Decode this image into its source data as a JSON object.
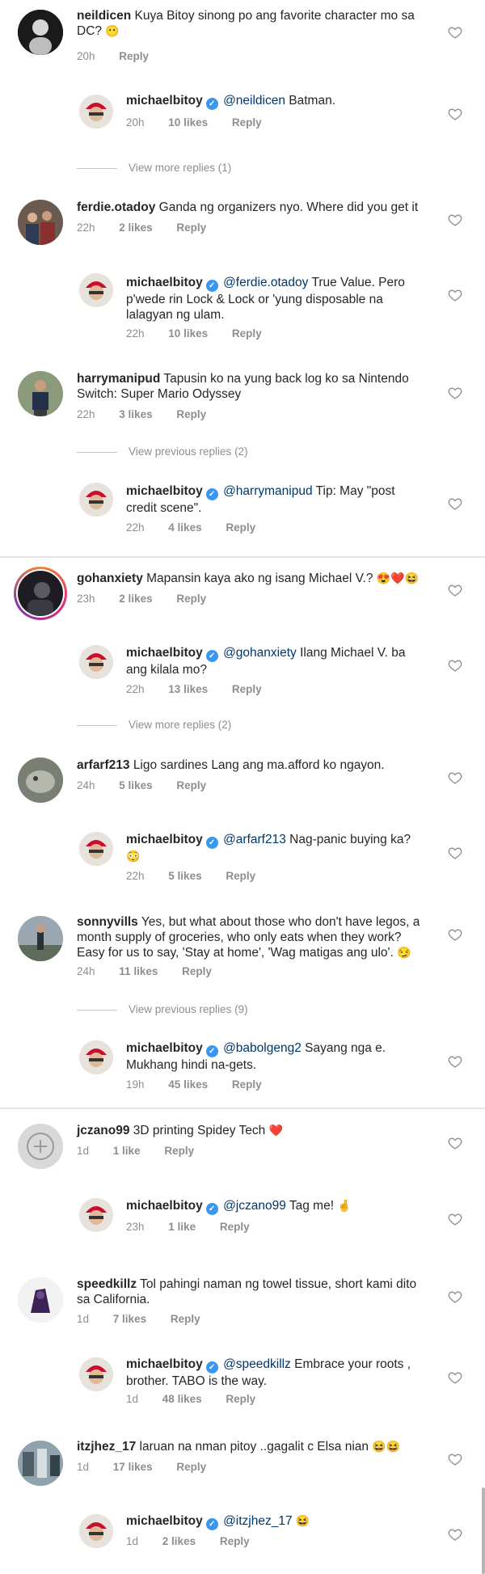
{
  "comments": [
    {
      "user": "neildicen",
      "text": "Kuya Bitoy sinong po ang favorite character mo sa DC?",
      "emoji": "😶",
      "time": "20h",
      "likes": "",
      "reply": "Reply",
      "replies": [
        {
          "user": "michaelbitoy",
          "mention": "@neildicen",
          "text": "Batman.",
          "emoji": "",
          "time": "20h",
          "likes": "10 likes",
          "reply": "Reply"
        }
      ],
      "view_more": "View more replies (1)"
    },
    {
      "user": "ferdie.otadoy",
      "text": "Ganda ng organizers nyo. Where did you get it",
      "emoji": "",
      "time": "22h",
      "likes": "2 likes",
      "reply": "Reply",
      "replies": [
        {
          "user": "michaelbitoy",
          "mention": "@ferdie.otadoy",
          "text": "True Value. Pero p'wede rin Lock & Lock or 'yung disposable na lalagyan ng ulam.",
          "emoji": "",
          "time": "22h",
          "likes": "10 likes",
          "reply": "Reply"
        }
      ],
      "view_more": ""
    },
    {
      "user": "harrymanipud",
      "text": "Tapusin ko na yung back log ko sa Nintendo Switch: Super Mario Odyssey",
      "emoji": "",
      "time": "22h",
      "likes": "3 likes",
      "reply": "Reply",
      "replies": [
        {
          "user": "michaelbitoy",
          "mention": "@harrymanipud",
          "text": "Tip: May \"post credit scene\".",
          "emoji": "",
          "time": "22h",
          "likes": "4 likes",
          "reply": "Reply"
        }
      ],
      "view_more": "View previous replies (2)"
    },
    {
      "user": "gohanxiety",
      "text": "Mapansin kaya ako ng isang Michael V.?",
      "emoji": "😍❤️😆",
      "time": "23h",
      "likes": "2 likes",
      "reply": "Reply",
      "replies": [
        {
          "user": "michaelbitoy",
          "mention": "@gohanxiety",
          "text": "Ilang Michael V. ba ang kilala mo?",
          "emoji": "",
          "time": "22h",
          "likes": "13 likes",
          "reply": "Reply"
        }
      ],
      "view_more": "View more replies (2)"
    },
    {
      "user": "arfarf213",
      "text": "Ligo sardines Lang ang ma.afford ko ngayon.",
      "emoji": "",
      "time": "24h",
      "likes": "5 likes",
      "reply": "Reply",
      "replies": [
        {
          "user": "michaelbitoy",
          "mention": "@arfarf213",
          "text": "Nag-panic buying ka?",
          "emoji": "😳",
          "time": "22h",
          "likes": "5 likes",
          "reply": "Reply"
        }
      ],
      "view_more": ""
    },
    {
      "user": "sonnyvills",
      "text": "Yes, but what about those who don't have legos, a month supply of groceries, who only eats when they work? Easy for us to say, 'Stay at home', 'Wag matigas ang ulo'.",
      "emoji": "😏",
      "time": "24h",
      "likes": "11 likes",
      "reply": "Reply",
      "replies": [
        {
          "user": "michaelbitoy",
          "mention": "@babolgeng2",
          "text": "Sayang nga e. Mukhang hindi na-gets.",
          "emoji": "",
          "time": "19h",
          "likes": "45 likes",
          "reply": "Reply"
        }
      ],
      "view_more": "View previous replies (9)"
    },
    {
      "user": "jczano99",
      "text": "3D printing Spidey Tech",
      "emoji": "❤️",
      "time": "1d",
      "likes": "1 like",
      "reply": "Reply",
      "replies": [
        {
          "user": "michaelbitoy",
          "mention": "@jczano99",
          "text": "Tag me!",
          "emoji": "🤞",
          "time": "23h",
          "likes": "1 like",
          "reply": "Reply"
        }
      ],
      "view_more": ""
    },
    {
      "user": "speedkillz",
      "text": "Tol pahingi naman ng towel tissue, short kami dito sa California.",
      "emoji": "",
      "time": "1d",
      "likes": "7 likes",
      "reply": "Reply",
      "replies": [
        {
          "user": "michaelbitoy",
          "mention": "@speedkillz",
          "text": "Embrace your roots , brother. TABO is the way.",
          "emoji": "",
          "time": "1d",
          "likes": "48 likes",
          "reply": "Reply"
        }
      ],
      "view_more": ""
    },
    {
      "user": "itzjhez_17",
      "text": "laruan na nman pitoy ..gagalit c Elsa nian",
      "emoji": "😆😆",
      "time": "1d",
      "likes": "17 likes",
      "reply": "Reply",
      "replies": [
        {
          "user": "michaelbitoy",
          "mention": "@itzjhez_17",
          "text": "",
          "emoji": "😆",
          "time": "1d",
          "likes": "2 likes",
          "reply": "Reply"
        }
      ],
      "view_more": ""
    }
  ],
  "icons": {
    "heart": "heart-outline-icon",
    "verified": "verified-badge-icon"
  },
  "colors": {
    "verified": "#3897f0",
    "mention": "#00376b",
    "meta": "#8e8e8e",
    "story_ring": "#dd2a7b"
  }
}
